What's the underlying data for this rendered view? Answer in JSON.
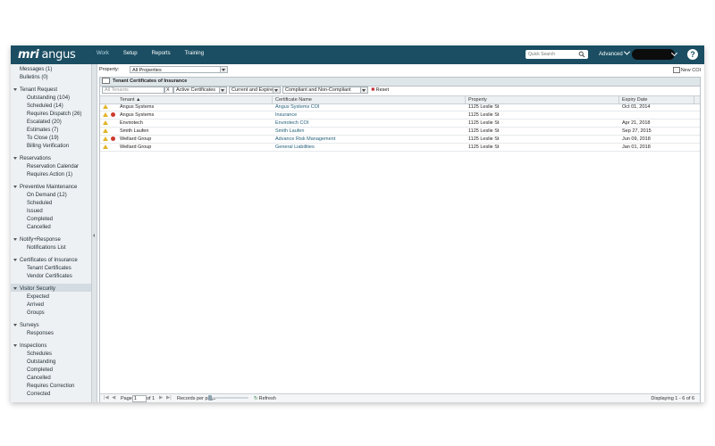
{
  "app": {
    "logo_mri": "mri",
    "logo_angus": "angus",
    "nav": [
      "Work",
      "Setup",
      "Reports",
      "Training"
    ],
    "search_placeholder": "Quick Search",
    "advanced_label": "Advanced",
    "help_label": "?"
  },
  "sidebar": {
    "top_items": [
      "Messages (1)",
      "Bulletins (0)"
    ],
    "groups": [
      {
        "title": "Tenant Request",
        "items": [
          "Outstanding (104)",
          "Scheduled (14)",
          "Requires Dispatch (26)",
          "Escalated (20)",
          "Estimates (7)",
          "To Close (19)",
          "Billing Verification"
        ]
      },
      {
        "title": "Reservations",
        "items": [
          "Reservation Calendar",
          "Requires Action (1)"
        ]
      },
      {
        "title": "Preventive Maintenance",
        "items": [
          "On Demand (12)",
          "Scheduled",
          "Issued",
          "Completed",
          "Cancelled"
        ]
      },
      {
        "title": "Notify+Response",
        "items": [
          "Notifications List"
        ]
      },
      {
        "title": "Certificates of Insurance",
        "items": [
          "Tenant Certificates",
          "Vendor Certificates"
        ]
      },
      {
        "title": "Visitor Security",
        "items": [
          "Expected",
          "Arrived",
          "Groups"
        ]
      },
      {
        "title": "Surveys",
        "items": [
          "Responses"
        ]
      },
      {
        "title": "Inspections",
        "items": [
          "Schedules",
          "Outstanding",
          "Completed",
          "Cancelled",
          "Requires Correction",
          "Corrected"
        ]
      }
    ],
    "selected": "Tenant Certificates"
  },
  "main": {
    "property_label": "Property:",
    "property_value": "All Properties",
    "new_coi_label": "New COI",
    "panel_title": "Tenant Certificates of Insurance",
    "filters": {
      "tenant_placeholder": "All Tenants",
      "tenant_btn": "X",
      "status": "Active Certificates",
      "period": "Current and Expired",
      "compliance": "Compliant and Non-Compliant",
      "reset": "Reset"
    },
    "columns": [
      "Tenant ▲",
      "Certificate Name",
      "Property",
      "Expiry Date"
    ],
    "rows": [
      {
        "icons": [
          "warn"
        ],
        "tenant": "Angus Systems",
        "certificate": "Angus Systems COI",
        "property": "1125 Leslie St",
        "expiry": "Oct 01, 2014"
      },
      {
        "icons": [
          "warn",
          "err"
        ],
        "tenant": "Angus Systems",
        "certificate": "Insurance",
        "property": "1125 Leslie St",
        "expiry": ""
      },
      {
        "icons": [
          "warn"
        ],
        "tenant": "Envirotech",
        "certificate": "Envirotech COI",
        "property": "1125 Leslie St",
        "expiry": "Apr 21, 2018"
      },
      {
        "icons": [
          "warn"
        ],
        "tenant": "Smith Laufen",
        "certificate": "Smith Laufen",
        "property": "1125 Leslie St",
        "expiry": "Sep 27, 2015"
      },
      {
        "icons": [
          "warn",
          "err"
        ],
        "tenant": "Wellard Group",
        "certificate": "Advance Risk Management",
        "property": "1125 Leslie St",
        "expiry": "Jun 09, 2018"
      },
      {
        "icons": [
          "warn"
        ],
        "tenant": "Wellard Group",
        "certificate": "General Liabilities",
        "property": "1125 Leslie St",
        "expiry": "Jan 01, 2018"
      }
    ],
    "footer": {
      "page_label": "Page",
      "page_value": "1",
      "of_label": "of 1",
      "records_label": "Records per page",
      "refresh_label": "Refresh",
      "display_text": "Displaying 1 - 6 of 6"
    }
  }
}
